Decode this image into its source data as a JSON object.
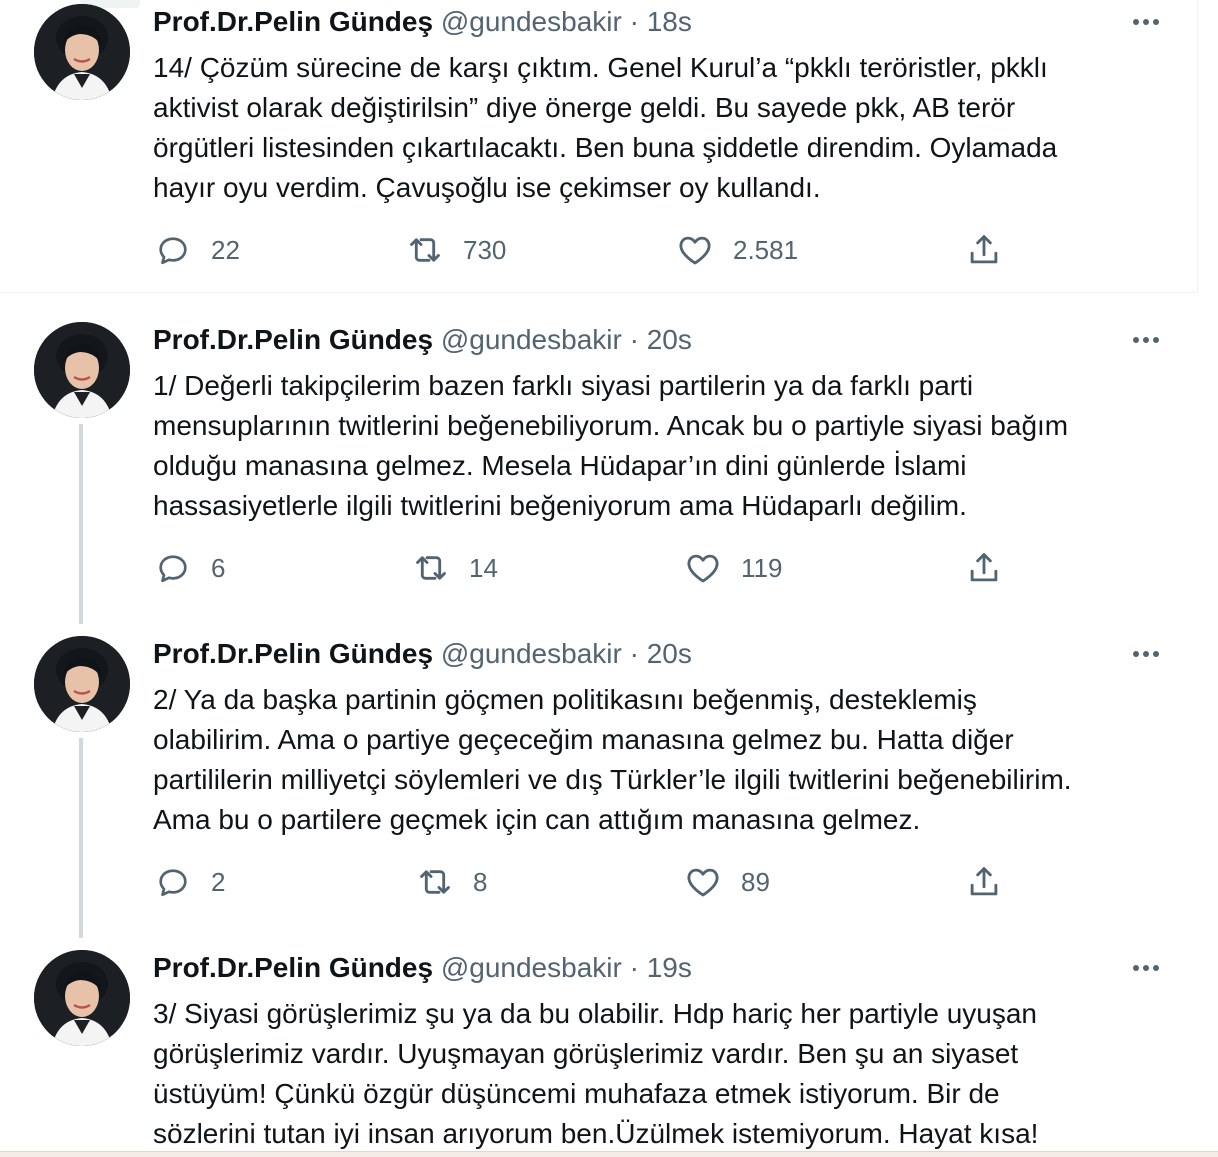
{
  "tweets": [
    {
      "name": "Prof.Dr.Pelin Gündeş",
      "handle": "@gundesbakir",
      "separator": "·",
      "time": "18s",
      "text": "14/ Çözüm sürecine de karşı çıktım. Genel Kurul’a “pkklı teröristler, pkklı\naktivist olarak değiştirilsin” diye önerge geldi. Bu sayede pkk, AB terör\nörgütleri listesinden çıkartılacaktı. Ben buna şiddetle direndim. Oylamada\nhayır oyu verdim. Çavuşoğlu ise çekimser oy kullandı.",
      "reply_count": "22",
      "retweet_count": "730",
      "like_count": "2.581"
    },
    {
      "name": "Prof.Dr.Pelin Gündeş",
      "handle": "@gundesbakir",
      "separator": "·",
      "time": "20s",
      "text": "1/ Değerli takipçilerim bazen farklı siyasi partilerin ya da farklı parti\nmensuplarının twitlerini beğenebiliyorum. Ancak bu o partiyle siyasi bağım\nolduğu manasına gelmez. Mesela Hüdapar’ın dini günlerde İslami\nhassasiyetlerle ilgili twitlerini beğeniyorum ama Hüdaparlı değilim.",
      "reply_count": "6",
      "retweet_count": "14",
      "like_count": "119"
    },
    {
      "name": "Prof.Dr.Pelin Gündeş",
      "handle": "@gundesbakir",
      "separator": "·",
      "time": "20s",
      "text": "2/ Ya da başka partinin göçmen politikasını beğenmiş, desteklemiş\nolabilirim. Ama o partiye geçeceğim manasına gelmez bu. Hatta diğer\npartililerin milliyetçi söylemleri ve dış Türkler’le ilgili twitlerini  beğenebilirim.\nAma bu o partilere geçmek için can attığım manasına gelmez.",
      "reply_count": "2",
      "retweet_count": "8",
      "like_count": "89"
    },
    {
      "name": "Prof.Dr.Pelin Gündeş",
      "handle": "@gundesbakir",
      "separator": "·",
      "time": "19s",
      "text": "3/ Siyasi görüşlerimiz şu ya da bu olabilir. Hdp hariç her partiyle uyuşan\ngörüşlerimiz vardır. Uyuşmayan görüşlerimiz vardır. Ben şu an siyaset\nüstüyüm! Çünkü özgür düşüncemi muhafaza etmek istiyorum. Bir de\nsözlerini tutan iyi insan arıyorum ben.Üzülmek istemiyorum. Hayat kısa!"
    }
  ],
  "icons": {
    "reply": "reply-icon",
    "retweet": "retweet-icon",
    "like": "heart-icon",
    "share": "share-icon",
    "more": "more-options-icon"
  },
  "colors": {
    "text": "#0f1419",
    "secondary": "#536471",
    "thread_line": "#cfd9de",
    "divider": "#eff3f4"
  }
}
